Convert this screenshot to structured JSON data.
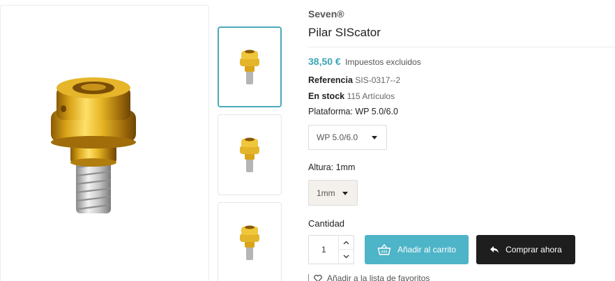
{
  "product": {
    "brand": "Seven®",
    "title": "Pilar SIScator",
    "price": "38,50 €",
    "tax_note": "Impuestos excluidos",
    "reference_label": "Referencia",
    "reference_value": "SIS-0317--2",
    "stock_label": "En stock",
    "stock_value": "115 Artículos"
  },
  "options": {
    "platform_label": "Plataforma: WP 5.0/6.0",
    "platform_selected": "WP 5.0/6.0",
    "height_label": "Altura: 1mm",
    "height_selected": "1mm"
  },
  "purchase": {
    "quantity_label": "Cantidad",
    "quantity_value": "1",
    "add_to_cart": "Añadir al carrito",
    "buy_now": "Comprar ahora",
    "wishlist": "Añadir a la lista de favoritos"
  },
  "gallery": {
    "thumbnails": [
      "abutment-thumbnail-1",
      "abutment-thumbnail-2",
      "abutment-thumbnail-3"
    ],
    "active_index": 0
  },
  "colors": {
    "accent": "#3aa6b9",
    "cart_button": "#4eb4c8",
    "buy_button": "#1e1e1e",
    "gold": "#d9a418"
  }
}
